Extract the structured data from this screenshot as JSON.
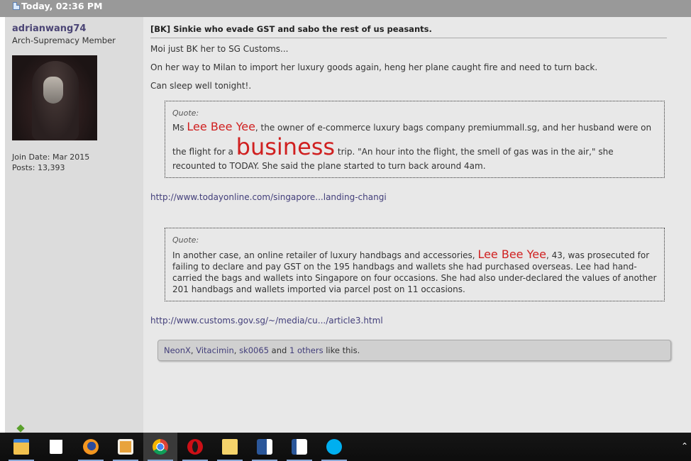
{
  "post": {
    "date": "Today, 02:36 PM",
    "title": "[BK] Sinkie who evade GST and sabo the rest of us peasants.",
    "paragraphs": [
      "Moi just BK her to SG Customs...",
      "On her way to Milan to import her luxury goods again, heng her plane caught fire and need to turn back.",
      "Can sleep well tonight!."
    ]
  },
  "user": {
    "name": "adrianwang74",
    "title": "Arch-Supremacy Member",
    "join_date": "Join Date: Mar 2015",
    "posts": "Posts: 13,393"
  },
  "quote1": {
    "label": "Quote:",
    "pre": "Ms ",
    "name": "Lee Bee Yee",
    "mid": ", the owner of e-commerce luxury bags company premiummall.sg, and her husband were on the flight for a ",
    "big_word": "business",
    "post": " trip. \"An hour into the flight, the smell of gas was in the air,\" she recounted to TODAY. She said the plane started to turn back around 4am."
  },
  "link1": "http://www.todayonline.com/singapore...landing-changi",
  "quote2": {
    "label": "Quote:",
    "pre": "In another case, an online retailer of luxury handbags and accessories, ",
    "name": "Lee Bee Yee",
    "post": ", 43, was prosecuted for failing to declare and pay GST on the 195 handbags and wallets she had purchased overseas. Lee had hand-carried the bags and wallets into Singapore on four occasions. She had also under-declared the values of another 201 handbags and wallets imported via parcel post on 11 occasions."
  },
  "link2": "http://www.customs.gov.sg/~/media/cu.../article3.html",
  "likes": {
    "users": [
      "NeonX",
      "Vitacimin",
      "sk0065"
    ],
    "sep": ", ",
    "and": " and ",
    "others": "1 others",
    "suffix": " like this."
  },
  "taskbar": {
    "icons": [
      "file-explorer-icon",
      "store-icon",
      "firefox-icon",
      "media-player-icon",
      "chrome-icon",
      "opera-icon",
      "folder-icon",
      "word-icon",
      "document-icon",
      "skype-icon"
    ],
    "colors": [
      "#f2c14e",
      "#ffffff",
      "#e66000",
      "#e8a33d",
      "#4285f4",
      "#cc0f16",
      "#f5d36b",
      "#2b579a",
      "#2b579a",
      "#00aff0"
    ]
  }
}
